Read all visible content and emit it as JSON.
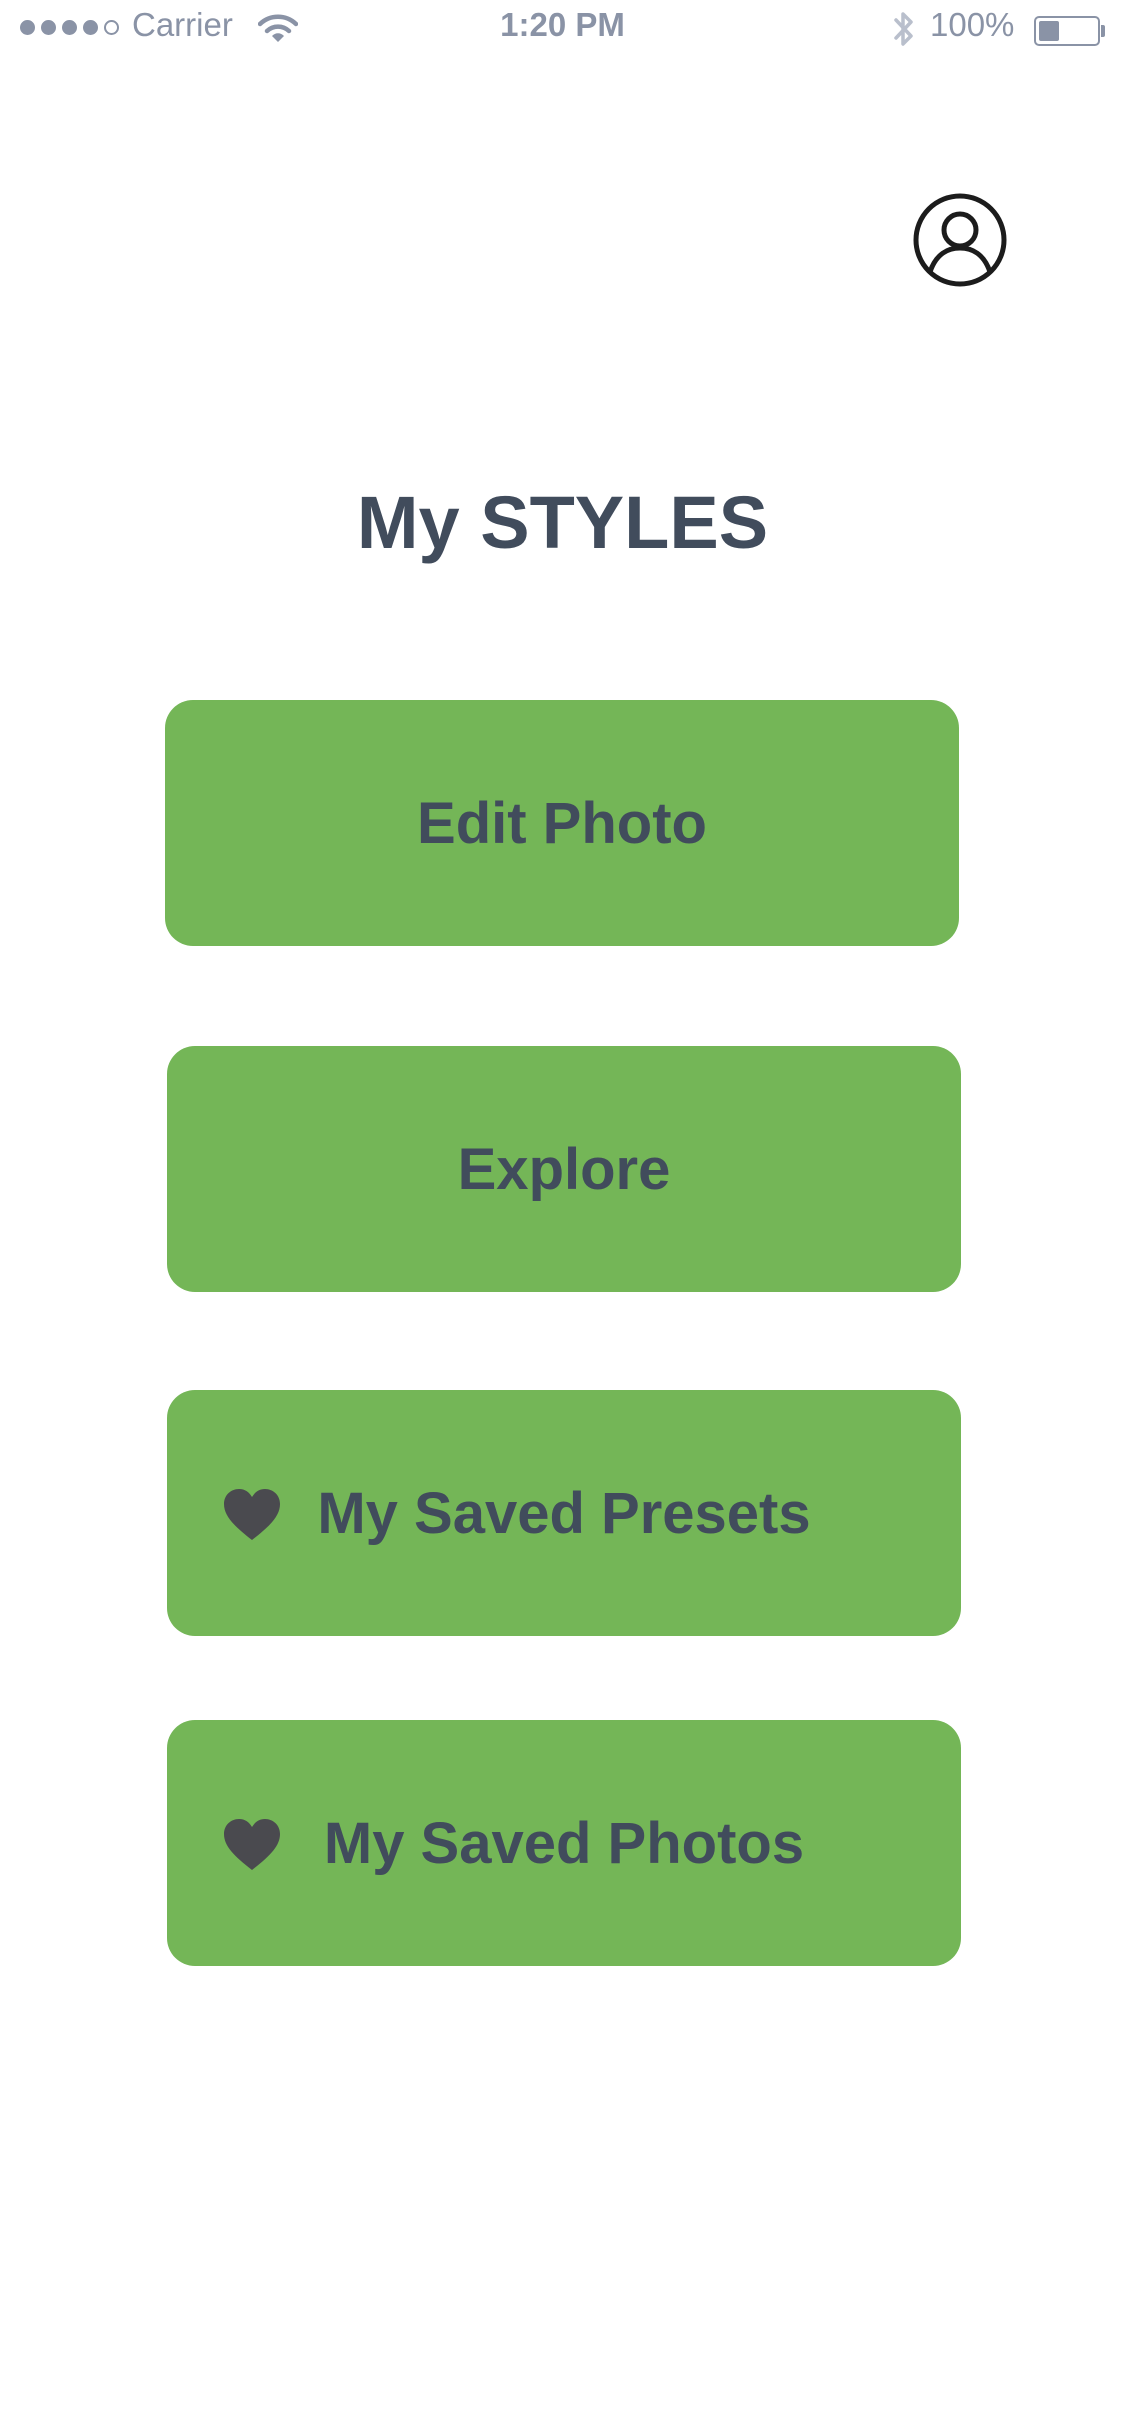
{
  "status_bar": {
    "carrier": "Carrier",
    "time": "1:20 PM",
    "battery": "100%",
    "signal_bars_filled": 4,
    "signal_bars_total": 5,
    "battery_level": 0.35,
    "icons": [
      "wifi-icon",
      "bluetooth-icon",
      "battery-icon"
    ]
  },
  "header": {
    "profile_icon": "user-circle-icon"
  },
  "main": {
    "title": "My STYLES",
    "buttons": [
      {
        "label": "Edit Photo",
        "icon": ""
      },
      {
        "label": "Explore",
        "icon": ""
      },
      {
        "label": "My Saved Presets",
        "icon": "heart-icon"
      },
      {
        "label": "My Saved Photos",
        "icon": "heart-icon"
      }
    ]
  },
  "colors": {
    "button_bg": "#74b657",
    "text_dark": "#414c5c",
    "status_gray": "#8a93a6",
    "heart": "#4a4a4f"
  }
}
